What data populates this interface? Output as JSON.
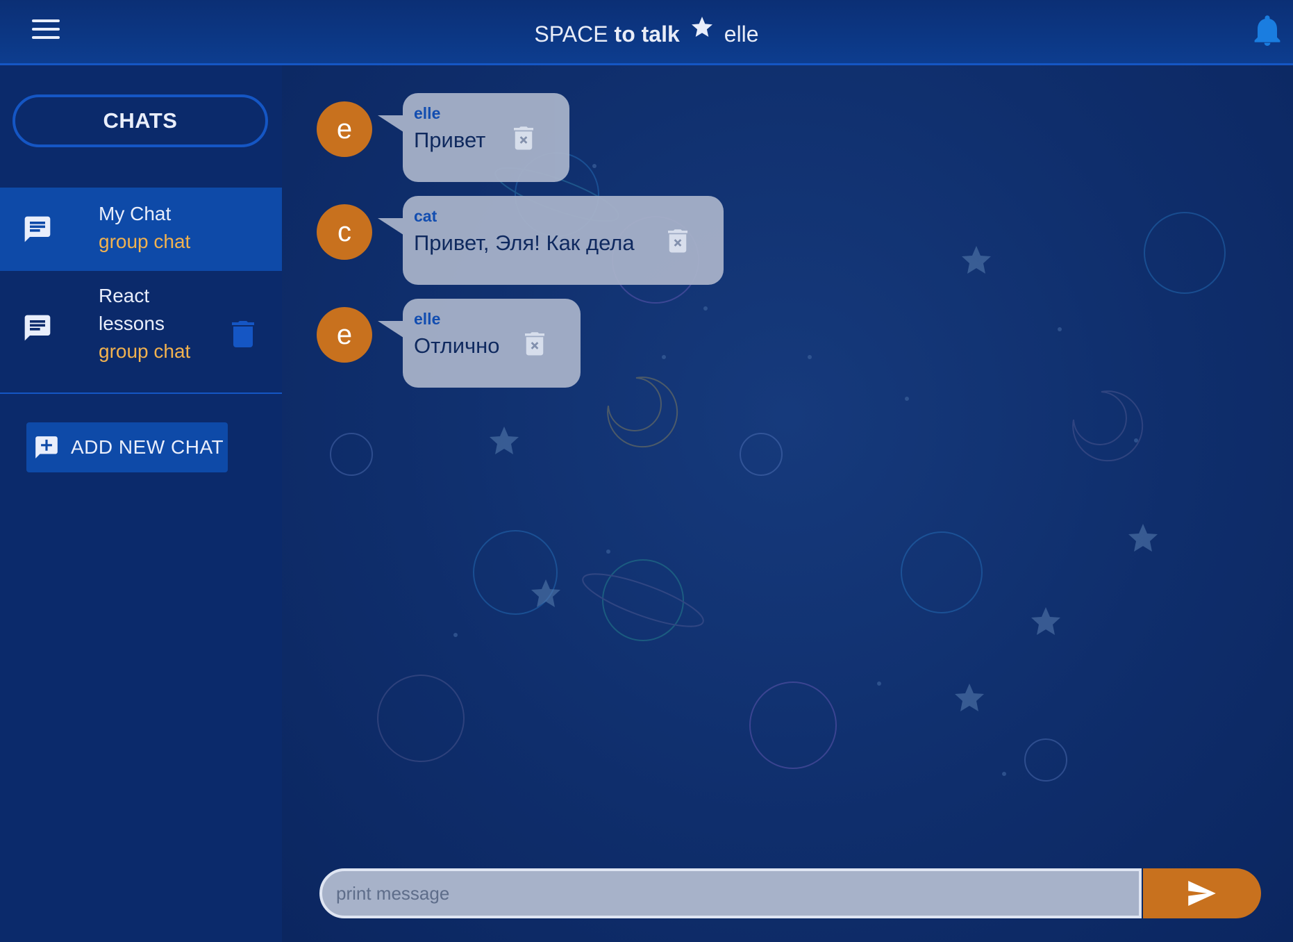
{
  "header": {
    "title_part1": "SPACE",
    "title_part2": "to talk",
    "username": "elle",
    "menu_icon": "hamburger-menu-icon",
    "star_icon": "star-icon",
    "bell_icon": "bell-icon"
  },
  "sidebar": {
    "chats_button_label": "CHATS",
    "chats": [
      {
        "name": "My Chat",
        "type": "group chat",
        "icon": "chat-bubble-icon",
        "active": true
      },
      {
        "name_line1": "React",
        "name_line2": "lessons",
        "type": "group chat",
        "icon": "chat-bubble-icon",
        "active": false,
        "delete_icon": "trash-icon"
      }
    ],
    "add_button_label": "ADD NEW CHAT",
    "add_icon": "add-chat-icon"
  },
  "messages": [
    {
      "avatar": "e",
      "author": "elle",
      "text": "Привет"
    },
    {
      "avatar": "c",
      "author": "cat",
      "text": "Привет, Эля! Как дела"
    },
    {
      "avatar": "e",
      "author": "elle",
      "text": "Отлично"
    }
  ],
  "composer": {
    "placeholder": "print message",
    "value": "",
    "send_icon": "send-arrow-icon"
  },
  "colors": {
    "background": "#0d2b66",
    "header": "#0b2f75",
    "accent_blue": "#1556c4",
    "active_item": "#0e4aa8",
    "avatar_orange": "#c8711e",
    "subtitle_orange": "#f2b24f",
    "bubble": "#a7b2c9",
    "author_blue": "#1450b5"
  }
}
